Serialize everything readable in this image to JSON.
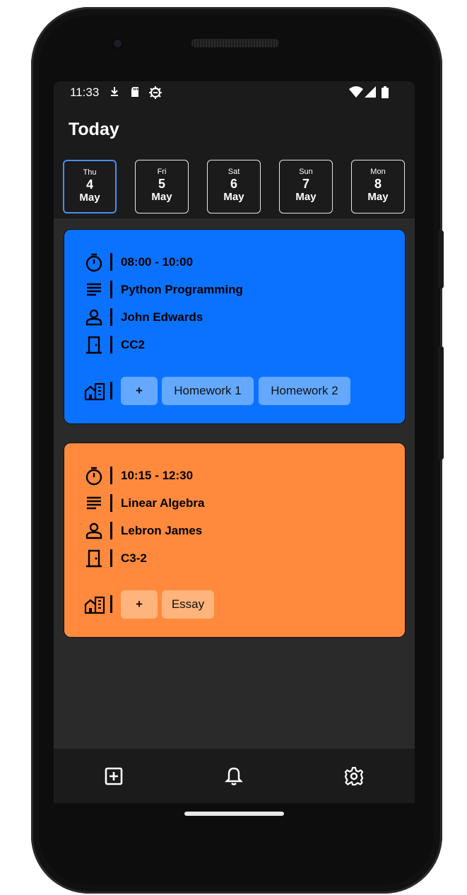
{
  "status_bar": {
    "time": "11:33"
  },
  "header": {
    "title": "Today"
  },
  "days": [
    {
      "dow": "Thu",
      "day": "4",
      "month": "May",
      "selected": true
    },
    {
      "dow": "Fri",
      "day": "5",
      "month": "May",
      "selected": false
    },
    {
      "dow": "Sat",
      "day": "6",
      "month": "May",
      "selected": false
    },
    {
      "dow": "Sun",
      "day": "7",
      "month": "May",
      "selected": false
    },
    {
      "dow": "Mon",
      "day": "8",
      "month": "May",
      "selected": false
    }
  ],
  "classes": [
    {
      "color": "#0a72ff",
      "time": "08:00 - 10:00",
      "subject": "Python Programming",
      "teacher": "John Edwards",
      "room": "CC2",
      "add_label": "+",
      "tasks": [
        "Homework 1",
        "Homework 2"
      ]
    },
    {
      "color": "#ff8a3d",
      "time": "10:15 - 12:30",
      "subject": "Linear Algebra",
      "teacher": "Lebron James",
      "room": "C3-2",
      "add_label": "+",
      "tasks": [
        "Essay"
      ]
    }
  ],
  "bottom_nav": {
    "items": [
      "add-icon",
      "bell-icon",
      "gear-icon"
    ]
  },
  "colors": {
    "screen_bg": "#2a2a2a",
    "bar_bg": "#1b1b1b",
    "selected_day_border": "#4a8cf0"
  }
}
